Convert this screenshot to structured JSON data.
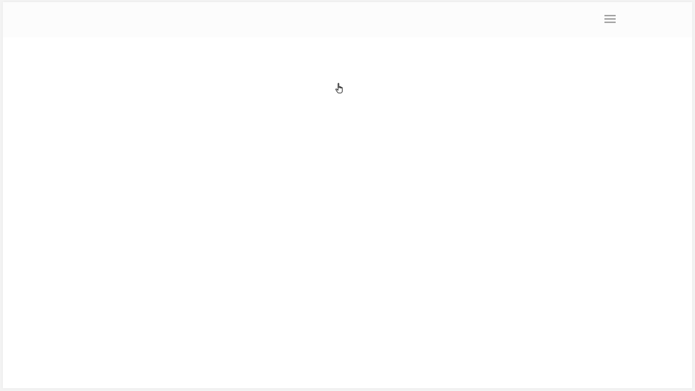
{
  "header": {
    "menu_icon": "hamburger-menu-icon"
  },
  "cursor": {
    "icon": "hand-pointer-cursor-icon"
  },
  "colors": {
    "page_background": "#f3f3f3",
    "content_background": "#ffffff",
    "header_background": "#fcfcfc",
    "menu_icon": "#8a8a8a"
  }
}
